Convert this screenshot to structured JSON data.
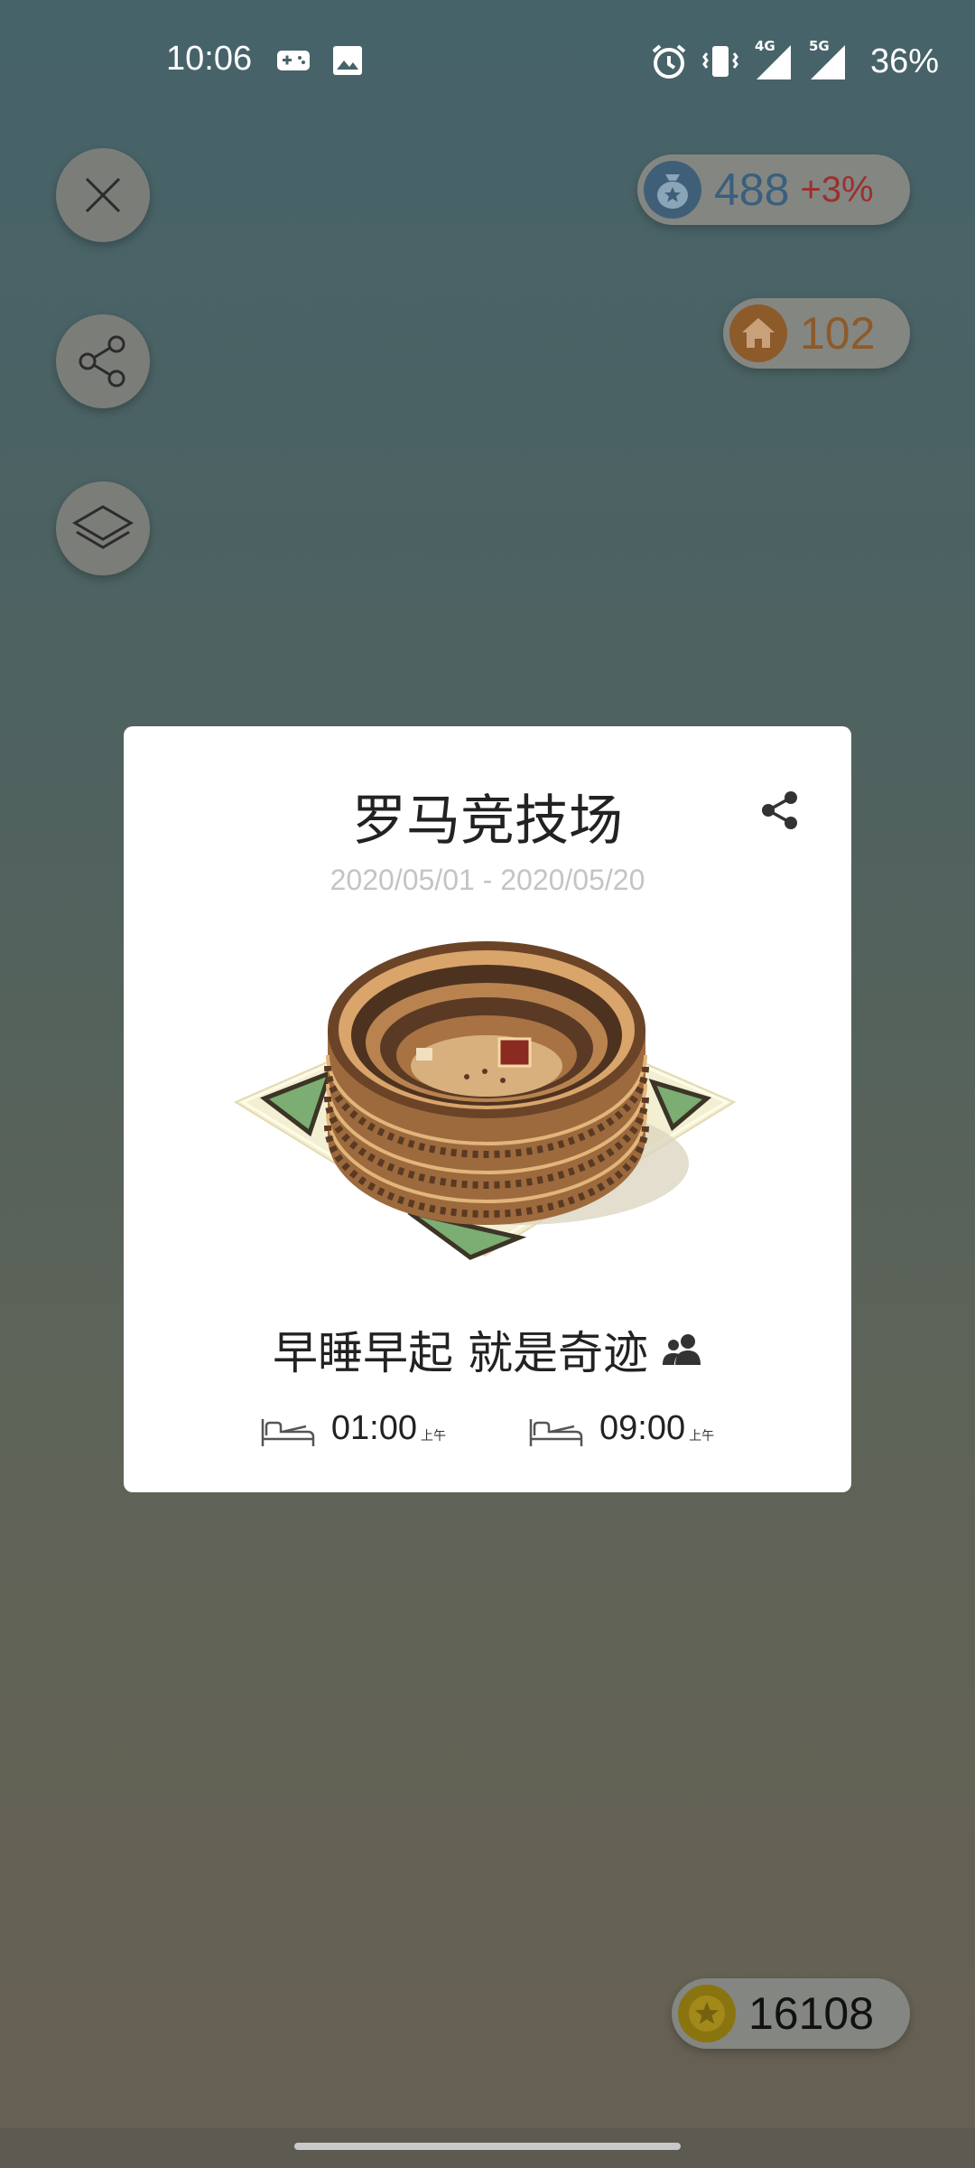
{
  "status_bar": {
    "time": "10:06",
    "battery": "36%",
    "left_icons": [
      "gamepad-icon",
      "image-icon"
    ],
    "right_icons": [
      "alarm-icon",
      "vibrate-icon",
      "signal-4g-icon",
      "signal-5g-icon"
    ],
    "signal_labels": {
      "first": "4G",
      "second": "5G"
    }
  },
  "left_buttons": [
    {
      "icon": "close-icon"
    },
    {
      "icon": "share-icon"
    },
    {
      "icon": "layers-icon"
    }
  ],
  "pills": {
    "money": {
      "icon": "money-bag-icon",
      "value": "488",
      "change": "+3%",
      "value_color": "#3a5f7d",
      "change_color": "#9c2f2f"
    },
    "home": {
      "icon": "house-icon",
      "value": "102",
      "value_color": "#8d5a2a"
    },
    "coins": {
      "icon": "coin-icon",
      "value": "16108",
      "value_color": "#111111"
    }
  },
  "card": {
    "title": "罗马竞技场",
    "date_range": "2020/05/01 - 2020/05/20",
    "image_icon": "colosseum-illustration",
    "slogan": "早睡早起 就是奇迹",
    "slogan_icon": "group-icon",
    "sleep": {
      "time": "01:00",
      "ampm": "上午",
      "icon": "bed-icon"
    },
    "wake": {
      "time": "09:00",
      "ampm": "上午",
      "icon": "bed-icon"
    }
  }
}
